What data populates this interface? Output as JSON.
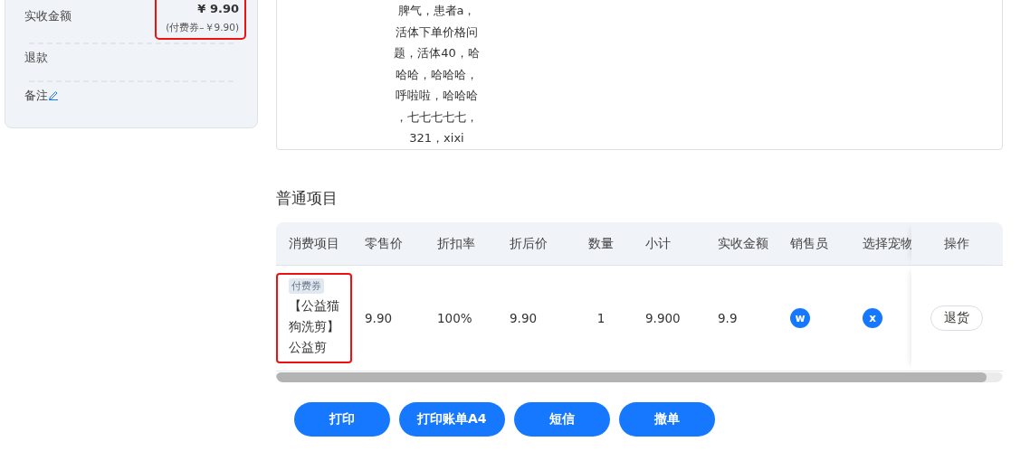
{
  "summary": {
    "rows": [
      {
        "kind": "amount",
        "label": "实收金额",
        "value": "¥ 9.90",
        "detail": "(付费券–￥9.90)",
        "highlighted": true
      },
      {
        "kind": "plain",
        "label": "退款"
      },
      {
        "kind": "note",
        "label": "备注"
      }
    ]
  },
  "note": {
    "text": "脾气，患者a，活体下单价格问题，活体40，哈哈哈，哈哈哈，呼啦啦，哈哈哈，七七七七七，321，xixi"
  },
  "section_title": "普通项目",
  "table": {
    "columns": [
      "消费项目",
      "零售价",
      "折扣率",
      "折后价",
      "数量",
      "小计",
      "实收金额",
      "销售员",
      "选择宠物",
      "操作"
    ],
    "rows": [
      {
        "cells": [
          {
            "kind": "item",
            "tag": "付费券",
            "text": "【公益猫狗洗剪】公益剪",
            "highlighted": true
          },
          {
            "kind": "text",
            "text": "9.90"
          },
          {
            "kind": "text",
            "text": "100%"
          },
          {
            "kind": "text",
            "text": "9.90"
          },
          {
            "kind": "text",
            "text": "1"
          },
          {
            "kind": "text",
            "text": "9.900"
          },
          {
            "kind": "text",
            "text": "9.9"
          },
          {
            "kind": "avatar",
            "text": "w"
          },
          {
            "kind": "avatar",
            "text": "x"
          },
          {
            "kind": "button",
            "text": "退货"
          }
        ]
      }
    ]
  },
  "buttons": [
    "打印",
    "打印账单A4",
    "短信",
    "撤单"
  ]
}
